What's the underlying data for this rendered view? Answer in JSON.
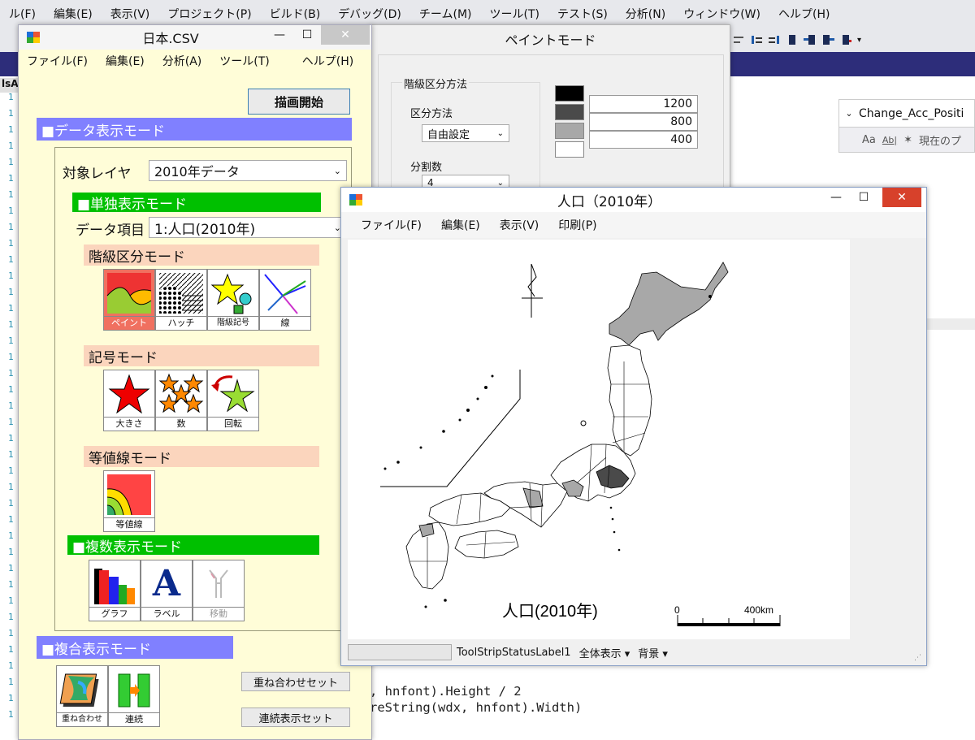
{
  "ide": {
    "menu": [
      "ル(F)",
      "編集(E)",
      "表示(V)",
      "プロジェクト(P)",
      "ビルド(B)",
      "デバッグ(D)",
      "チーム(M)",
      "ツール(T)",
      "テスト(S)",
      "分析(N)",
      "ウィンドウ(W)",
      "ヘルプ(H)"
    ],
    "tab_fragment": "lsA",
    "prop_combo": "Change_Acc_Positi",
    "prop_toolbar_text": "現在のプ",
    "code_lines": [
      ", hnfont).Height / 2",
      "reString(wdx, hnfont).Width)"
    ],
    "line_numbers": [
      "1",
      "1",
      "1",
      "1",
      "1",
      "1",
      "1",
      "1",
      "1",
      "1",
      "1",
      "1",
      "1",
      "1",
      "1",
      "1",
      "1",
      "1",
      "1",
      "1",
      "1",
      "1",
      "1",
      "1",
      "1",
      "1",
      "1",
      "1",
      "1",
      "1",
      "1",
      "1",
      "1",
      "1",
      "1",
      "1",
      "1",
      "1",
      "1",
      "1"
    ]
  },
  "main_window": {
    "title": "日本.CSV",
    "menu": [
      "ファイル(F)",
      "編集(E)",
      "分析(A)",
      "ツール(T)",
      "ヘルプ(H)"
    ],
    "draw_button": "描画開始",
    "data_mode_header": "■データ表示モード",
    "target_layer_label": "対象レイヤ",
    "target_layer_value": "2010年データ",
    "single_mode_header": "■単独表示モード",
    "data_item_label": "データ項目",
    "data_item_value": "1:人口(2010年)",
    "class_mode_header": "階級区分モード",
    "class_tools": [
      "ペイント",
      "ハッチ",
      "階級記号",
      "線"
    ],
    "symbol_mode_header": "記号モード",
    "symbol_tools": [
      "大きさ",
      "数",
      "回転"
    ],
    "contour_mode_header": "等値線モード",
    "contour_tools": [
      "等値線"
    ],
    "multi_mode_header": "■複数表示モード",
    "multi_tools": [
      "グラフ",
      "ラベル",
      "移動"
    ],
    "composite_header": "■複合表示モード",
    "composite_tools": [
      "重ね合わせ",
      "連続"
    ],
    "overlay_set_button": "重ね合わせセット",
    "continuous_set_button": "連続表示セット"
  },
  "paint_window": {
    "title": "ペイントモード",
    "group_label": "階級区分方法",
    "method_label": "区分方法",
    "method_value": "自由設定",
    "div_label": "分割数",
    "div_value": "4",
    "colors": [
      "#000000",
      "#4a4a4a",
      "#a8a8a8",
      "#ffffff"
    ],
    "thresholds": [
      "1200",
      "800",
      "400"
    ]
  },
  "map_window": {
    "title": "人口（2010年）",
    "menu": [
      "ファイル(F)",
      "編集(E)",
      "表示(V)",
      "印刷(P)"
    ],
    "map_title": "人口(2010年)",
    "scale_start": "0",
    "scale_end": "400km",
    "status_label": "ToolStripStatusLabel1",
    "view_all": "全体表示 ▾",
    "background": "背景 ▾"
  }
}
